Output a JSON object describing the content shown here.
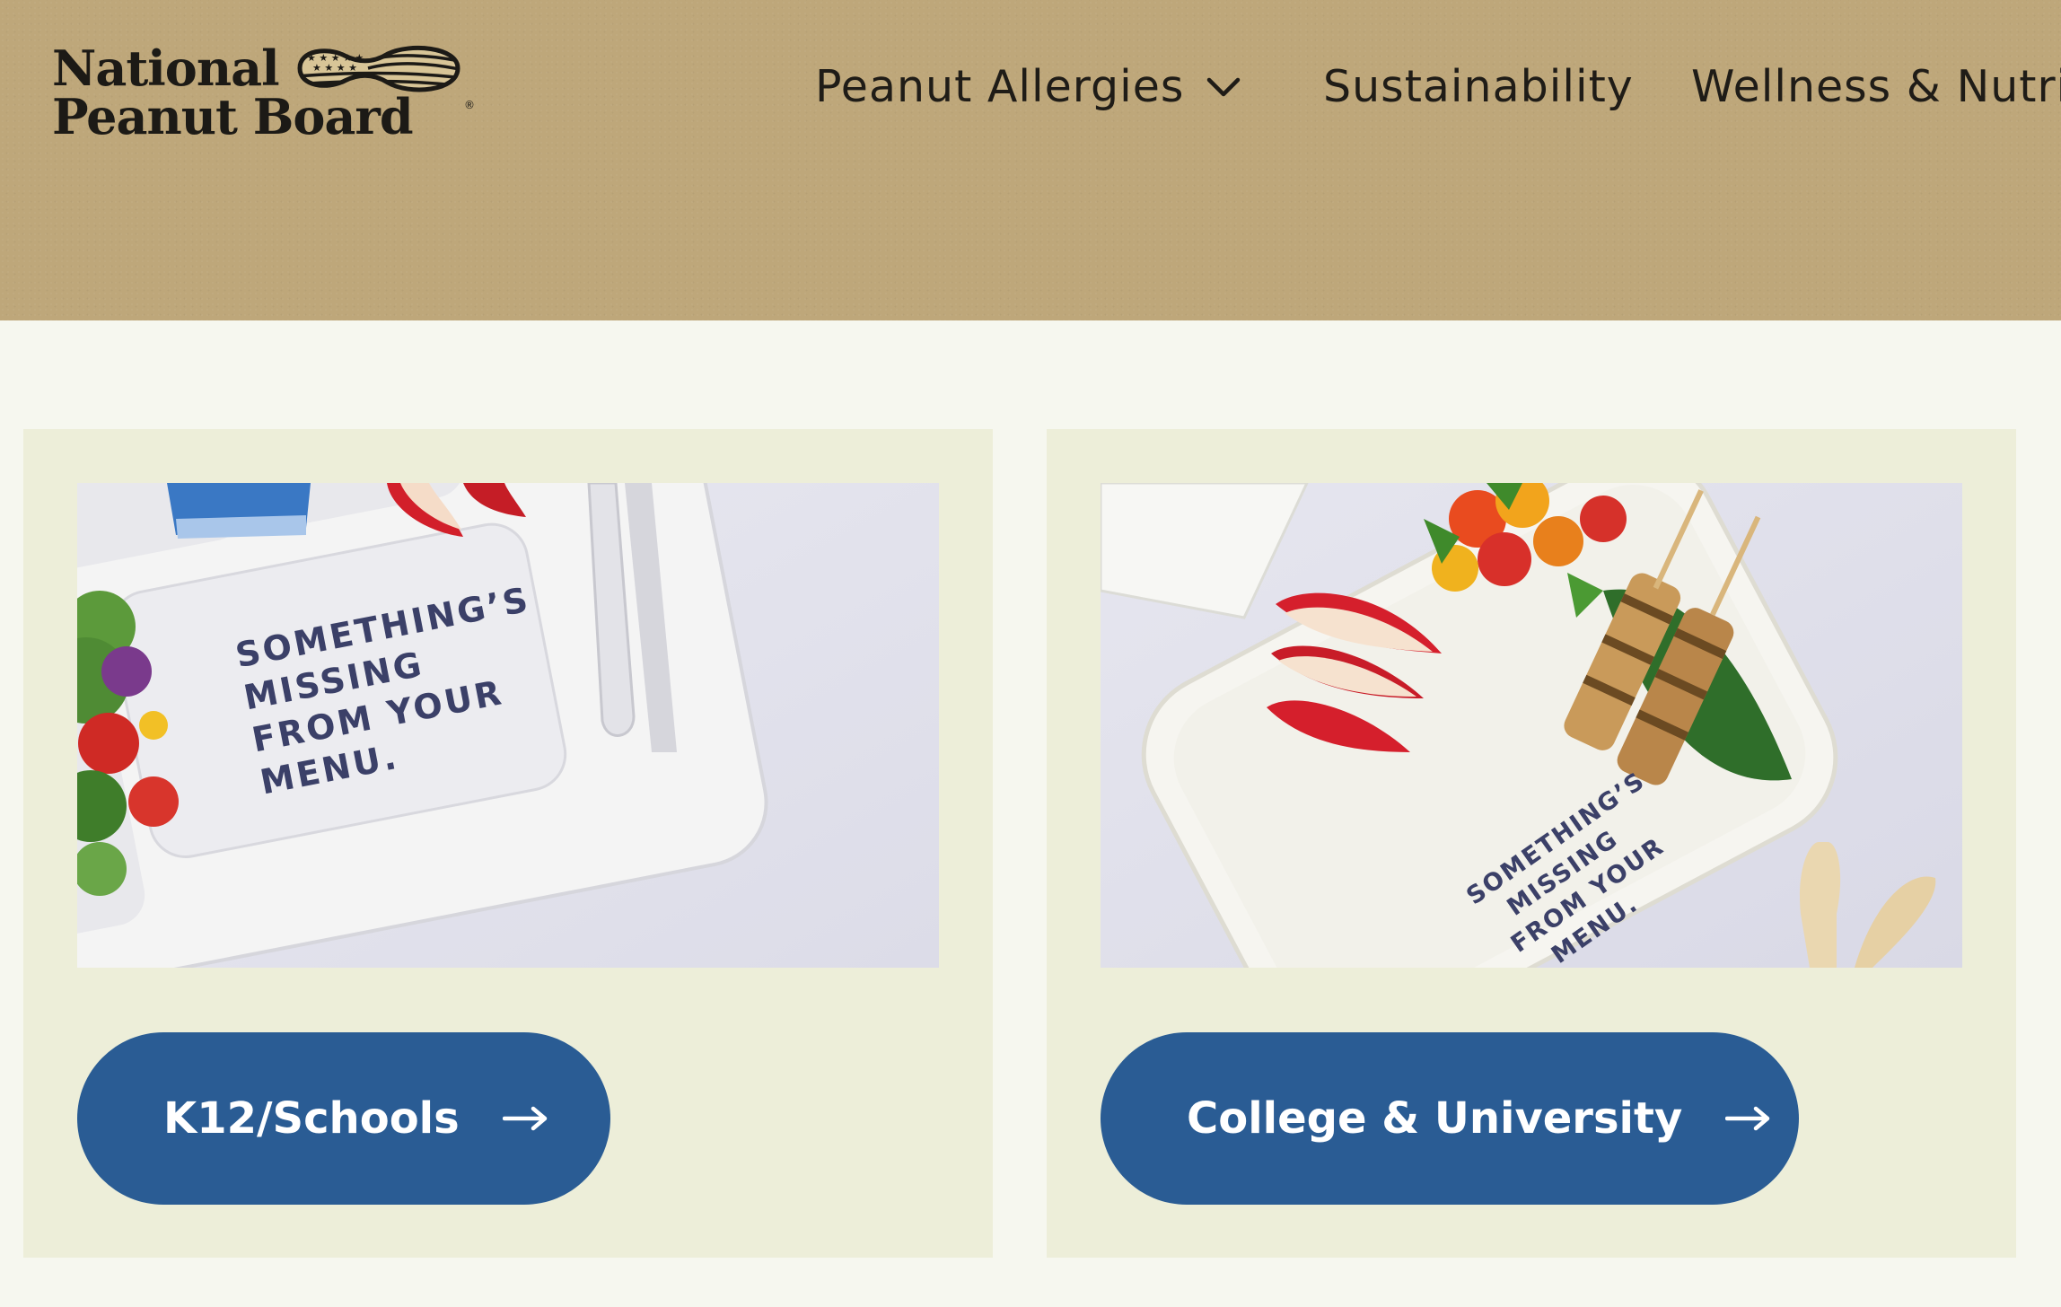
{
  "header": {
    "logo": {
      "line1": "National",
      "line2": "Peanut Board",
      "icon": "peanut-flag-icon"
    },
    "nav": {
      "items": [
        {
          "label": "Peanut Allergies",
          "icon": "chevron-down-icon"
        },
        {
          "label": "Sustainability"
        },
        {
          "label": "Wellness & Nutrit"
        }
      ]
    }
  },
  "cards": [
    {
      "image_text": [
        "SOMETHING’S",
        "MISSING",
        "FROM YOUR",
        "MENU."
      ],
      "button_label": "K12/Schools",
      "button_icon": "arrow-right-icon"
    },
    {
      "image_text": [
        "SOMETHING’S",
        "MISSING",
        "FROM YOUR",
        "MENU."
      ],
      "button_label": "College & University",
      "button_icon": "arrow-right-icon"
    }
  ],
  "colors": {
    "header_bg": "#bea77a",
    "page_bg": "#f6f7ef",
    "card_bg": "#edeed9",
    "button_bg": "#2a5c94",
    "text_dark": "#1f1c17"
  }
}
